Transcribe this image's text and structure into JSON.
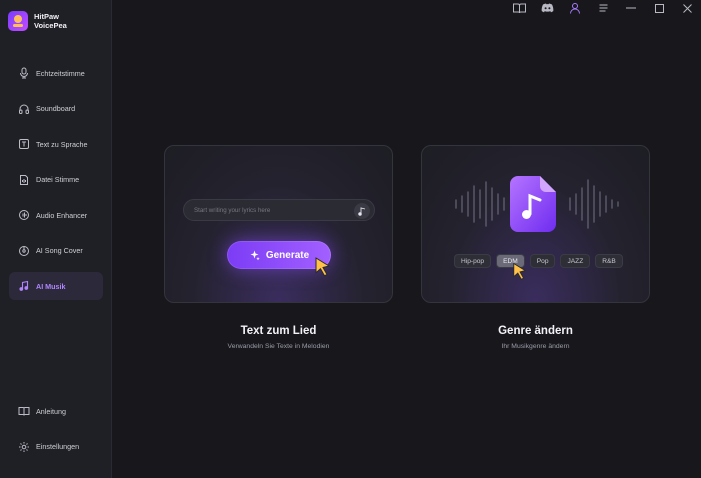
{
  "app": {
    "name_line1": "HitPaw",
    "name_line2": "VoicePea"
  },
  "sidebar": {
    "items": [
      {
        "label": "Echtzeitstimme",
        "icon": "microphone-icon"
      },
      {
        "label": "Soundboard",
        "icon": "headphones-icon"
      },
      {
        "label": "Text zu Sprache",
        "icon": "text-to-speech-icon"
      },
      {
        "label": "Datei Stimme",
        "icon": "file-voice-icon"
      },
      {
        "label": "Audio Enhancer",
        "icon": "audio-enhancer-icon"
      },
      {
        "label": "AI Song Cover",
        "icon": "song-cover-icon"
      },
      {
        "label": "AI Musik",
        "icon": "music-note-icon",
        "active": true
      }
    ],
    "bottom_items": [
      {
        "label": "Anleitung",
        "icon": "book-icon"
      },
      {
        "label": "Einstellungen",
        "icon": "settings-icon"
      }
    ]
  },
  "topbar": {
    "icons": [
      "guide-book-icon",
      "discord-icon",
      "user-icon",
      "menu-icon",
      "minimize-icon",
      "maximize-icon",
      "close-icon"
    ]
  },
  "cards": {
    "lyrics": {
      "input_placeholder": "Start writing your lyrics here",
      "generate_label": "Generate",
      "title": "Text zum Lied",
      "subtitle": "Verwandeln Sie Texte in Melodien"
    },
    "genre": {
      "genres": [
        "Hip-pop",
        "EDM",
        "Pop",
        "JAZZ",
        "R&B"
      ],
      "selected_genre": "EDM",
      "title": "Genre ändern",
      "subtitle": "Ihr Musikgenre ändern"
    }
  },
  "colors": {
    "accent": "#9b5cff",
    "background": "#17171c",
    "sidebar": "#1f1f26"
  }
}
